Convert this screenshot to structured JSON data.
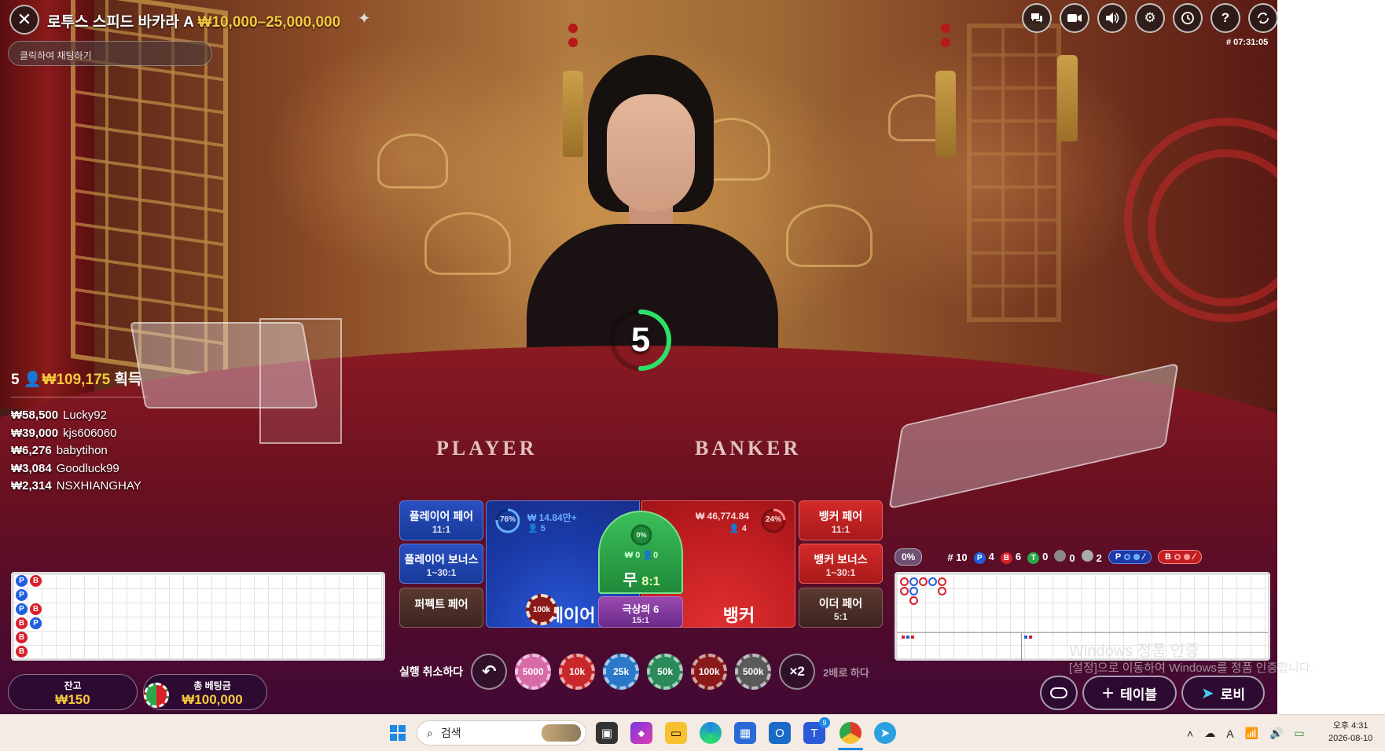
{
  "header": {
    "title": "로투스 스피드 바카라 A",
    "limits": "₩10,000–25,000,000",
    "chat_placeholder": "클릭하여 채팅하기",
    "game_id": "# 07:31:05"
  },
  "timer": {
    "seconds": "5",
    "progress": 0.5
  },
  "table_text": {
    "player": "PLAYER",
    "banker": "BANKER"
  },
  "winners": {
    "count": "5",
    "total": "₩109,175",
    "suffix": "획득",
    "list": [
      {
        "amount": "₩58,500",
        "name": "Lucky92"
      },
      {
        "amount": "₩39,000",
        "name": "kjs606060"
      },
      {
        "amount": "₩6,276",
        "name": "babytihon"
      },
      {
        "amount": "₩3,084",
        "name": "Goodluck99"
      },
      {
        "amount": "₩2,314",
        "name": "NSXHIANGHAY"
      }
    ]
  },
  "bets": {
    "player_pair": {
      "label": "플레이어 페어",
      "odds": "11:1"
    },
    "player_bonus": {
      "label": "플레이어 보너스",
      "odds": "1~30:1"
    },
    "perfect_pair": {
      "label": "퍼펙트 페어"
    },
    "player": {
      "label": "플레이어",
      "amount": "₩ 14.84만+",
      "players": "5",
      "pct": "76%"
    },
    "tie": {
      "label": "무",
      "odds": "8:1",
      "amount": "₩ 0",
      "players": "0",
      "pct": "0%"
    },
    "super6": {
      "label": "극상의 6",
      "odds": "15:1"
    },
    "banker": {
      "label": "뱅커",
      "amount": "₩ 46,774.84",
      "players": "4",
      "pct": "24%"
    },
    "banker_pair": {
      "label": "뱅커 페어",
      "odds": "11:1"
    },
    "banker_bonus": {
      "label": "뱅커 보너스",
      "odds": "1~30:1"
    },
    "either_pair": {
      "label": "이더 페어",
      "odds": "5:1"
    },
    "placed_chip": "100k"
  },
  "chips": {
    "undo_label": "실행 취소하다",
    "double_label": "2배로 하다",
    "double_icon": "×2",
    "values": [
      "5000",
      "10k",
      "25k",
      "50k",
      "100k",
      "500k"
    ],
    "colors": [
      "#d86aa8",
      "#c8282a",
      "#2a78c8",
      "#2a8a5a",
      "#8a1a1a",
      "#5a5a5a"
    ]
  },
  "balance": {
    "label": "잔고",
    "value": "₩150"
  },
  "total_bet": {
    "label": "총 베팅금",
    "value": "₩100,000"
  },
  "stats": {
    "pct": "0%",
    "rounds": "# 10",
    "player": "4",
    "banker": "6",
    "tie": "0",
    "player_pair": "0",
    "banker_pair": "2",
    "p_letter": "P",
    "b_letter": "B",
    "t_letter": "T"
  },
  "bead_road": [
    "P",
    "B",
    "P",
    "P",
    "B",
    "B",
    "B",
    "B",
    "B",
    "P"
  ],
  "buttons": {
    "table": "테이블",
    "lobby": "로비"
  },
  "activation": {
    "title": "Windows 정품 인증",
    "subtitle": "[설정]으로 이동하여 Windows를 정품 인증합니다."
  },
  "taskbar": {
    "search": "검색",
    "badge": "9",
    "time": "오후 4:31",
    "date": "2026-08-10",
    "lang": "A"
  },
  "colors": {
    "gold": "#f6c93e",
    "player": "#1e5fe0",
    "banker": "#d81f2a",
    "tie": "#2aa84a"
  }
}
